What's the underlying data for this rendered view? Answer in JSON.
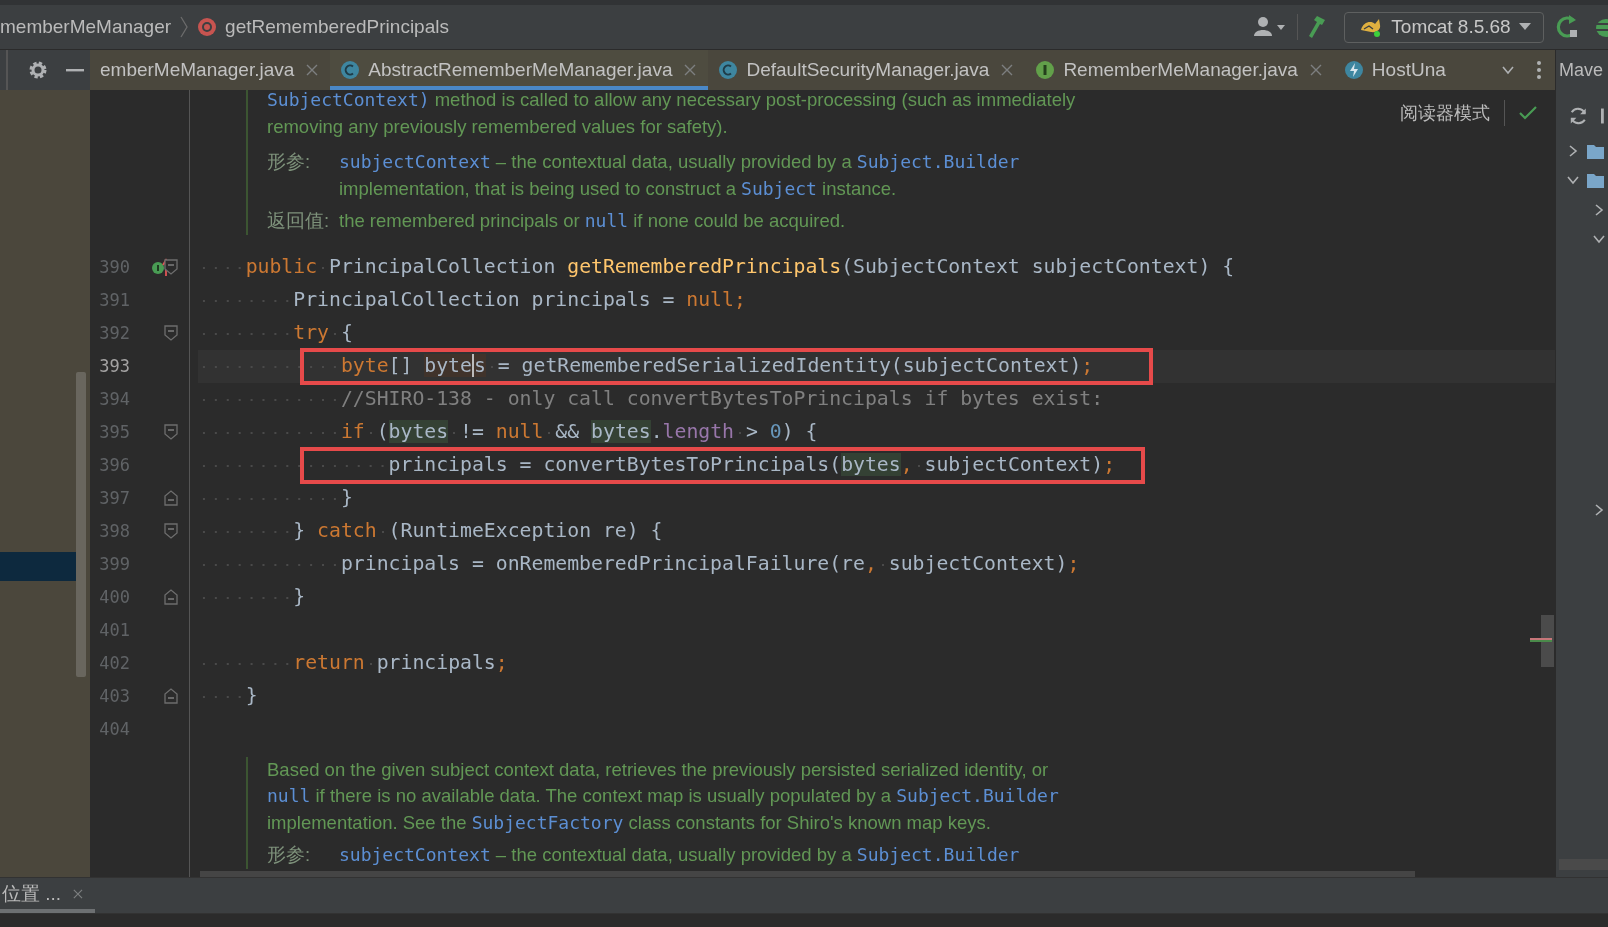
{
  "breadcrumb": [
    {
      "label": "memberMeManager"
    },
    {
      "label": "getRememberedPrincipals",
      "kind": "method"
    }
  ],
  "run_config": {
    "label": "Tomcat 8.5.68"
  },
  "tabs": [
    {
      "label": "emberMeManager.java",
      "selected": false,
      "closable": true
    },
    {
      "label": "AbstractRememberMeManager.java",
      "kind": "class",
      "selected": true,
      "closable": true
    },
    {
      "label": "DefaultSecurityManager.java",
      "kind": "class",
      "selected": false,
      "closable": true
    },
    {
      "label": "RememberMeManager.java",
      "kind": "interface",
      "selected": false,
      "closable": true
    },
    {
      "label": "HostUna",
      "kind": "bolt",
      "selected": false,
      "closable": false
    }
  ],
  "right_panel": {
    "title": "Mave",
    "tree": [
      {
        "expanded": false
      },
      {
        "expanded": true,
        "children": [
          {
            "expanded": false
          },
          {
            "expanded": true
          }
        ]
      }
    ]
  },
  "editor": {
    "reader_mode": "阅读器模式",
    "doc_top": [
      {
        "kind": "para",
        "lines": [
          [
            {
              "text": "SubjectContext)",
              "kind": "code"
            },
            {
              "text": " method is called to allow any necessary post-processing (such as immediately",
              "kind": "text"
            }
          ],
          [
            {
              "text": "removing any previously remembered values for safety).",
              "kind": "text"
            }
          ]
        ]
      },
      {
        "kind": "tag",
        "label": "形参:",
        "lines": [
          [
            {
              "text": "subjectContext",
              "kind": "code"
            },
            {
              "text": " – the contextual data, usually provided by a ",
              "kind": "text"
            },
            {
              "text": "Subject.Builder",
              "kind": "code"
            }
          ],
          [
            {
              "text": "implementation, that is being used to construct a ",
              "kind": "text"
            },
            {
              "text": "Subject",
              "kind": "code"
            },
            {
              "text": " instance.",
              "kind": "text"
            }
          ]
        ]
      },
      {
        "kind": "tag",
        "label": "返回值:",
        "lines": [
          [
            {
              "text": "the remembered principals or ",
              "kind": "text"
            },
            {
              "text": "null",
              "kind": "code"
            },
            {
              "text": " if none could be acquired.",
              "kind": "text"
            }
          ]
        ]
      }
    ],
    "code": [
      {
        "number": "390",
        "fold_start": true,
        "fold_end": false,
        "implements": true,
        "current": false,
        "boxed": false,
        "tokens": [
          {
            "text": "    public",
            "kind": "kw"
          },
          {
            "text": " PrincipalCollection ",
            "kind": "plain"
          },
          {
            "text": "getRememberedPrincipals",
            "kind": "fn"
          },
          {
            "text": "(SubjectContext subjectContext) {",
            "kind": "plain"
          }
        ]
      },
      {
        "number": "391",
        "current": false,
        "boxed": false,
        "tokens": [
          {
            "text": "        PrincipalCollection principals = ",
            "kind": "plain"
          },
          {
            "text": "null",
            "kind": "kw"
          },
          {
            "text": ";",
            "kind": "kw"
          }
        ]
      },
      {
        "number": "392",
        "fold_start": true,
        "fold_end": false,
        "current": false,
        "boxed": false,
        "tokens": [
          {
            "text": "        try",
            "kind": "kw"
          },
          {
            "text": " {",
            "kind": "plain"
          }
        ]
      },
      {
        "number": "393",
        "current": true,
        "boxed": true,
        "tokens": [
          {
            "text": "            byte",
            "kind": "kw"
          },
          {
            "text": "[] ",
            "kind": "plain"
          },
          {
            "text": "byte",
            "kind": "write"
          },
          {
            "text": "s",
            "kind": "write",
            "caret": true
          },
          {
            "text": " = getRememberedSerializedIdentity(subjectContext)",
            "kind": "plain"
          },
          {
            "text": ";",
            "kind": "kw"
          }
        ]
      },
      {
        "number": "394",
        "current": false,
        "boxed": false,
        "tokens": [
          {
            "text": "            //SHIRO-138 - only call convertBytesToPrincipals if bytes exist:",
            "kind": "comment"
          }
        ]
      },
      {
        "number": "395",
        "fold_start": true,
        "fold_end": false,
        "current": false,
        "boxed": false,
        "tokens": [
          {
            "text": "            if",
            "kind": "kw"
          },
          {
            "text": " (",
            "kind": "plain"
          },
          {
            "text": "bytes",
            "kind": "read"
          },
          {
            "text": " != ",
            "kind": "plain"
          },
          {
            "text": "null",
            "kind": "kw"
          },
          {
            "text": " && ",
            "kind": "plain"
          },
          {
            "text": "bytes",
            "kind": "read"
          },
          {
            "text": ".",
            "kind": "plain"
          },
          {
            "text": "length",
            "kind": "field"
          },
          {
            "text": " > ",
            "kind": "plain"
          },
          {
            "text": "0",
            "kind": "num"
          },
          {
            "text": ") {",
            "kind": "plain"
          }
        ]
      },
      {
        "number": "396",
        "current": false,
        "boxed": true,
        "tokens": [
          {
            "text": "                principals = convertBytesToPrincipals(",
            "kind": "plain"
          },
          {
            "text": "bytes",
            "kind": "read"
          },
          {
            "text": ",",
            "kind": "kw"
          },
          {
            "text": " subjectContext)",
            "kind": "plain"
          },
          {
            "text": ";",
            "kind": "kw"
          }
        ]
      },
      {
        "number": "397",
        "fold_start": false,
        "fold_end": true,
        "current": false,
        "boxed": false,
        "tokens": [
          {
            "text": "            }",
            "kind": "plain"
          }
        ]
      },
      {
        "number": "398",
        "fold_start": true,
        "fold_end": false,
        "current": false,
        "boxed": false,
        "tokens": [
          {
            "text": "        } ",
            "kind": "plain"
          },
          {
            "text": "catch",
            "kind": "kw"
          },
          {
            "text": " (RuntimeException re) {",
            "kind": "plain"
          }
        ]
      },
      {
        "number": "399",
        "current": false,
        "boxed": false,
        "tokens": [
          {
            "text": "            principals = onRememberedPrincipalFailure(re",
            "kind": "plain"
          },
          {
            "text": ",",
            "kind": "kw"
          },
          {
            "text": " subjectContext)",
            "kind": "plain"
          },
          {
            "text": ";",
            "kind": "kw"
          }
        ]
      },
      {
        "number": "400",
        "fold_start": false,
        "fold_end": true,
        "current": false,
        "boxed": false,
        "tokens": [
          {
            "text": "        }",
            "kind": "plain"
          }
        ]
      },
      {
        "number": "401",
        "current": false,
        "boxed": false
      },
      {
        "number": "402",
        "current": false,
        "boxed": false,
        "tokens": [
          {
            "text": "        return",
            "kind": "kw"
          },
          {
            "text": " principals",
            "kind": "plain"
          },
          {
            "text": ";",
            "kind": "kw"
          }
        ]
      },
      {
        "number": "403",
        "fold_start": false,
        "fold_end": true,
        "current": false,
        "boxed": false,
        "tokens": [
          {
            "text": "    }",
            "kind": "plain"
          }
        ]
      },
      {
        "number": "404",
        "current": false,
        "boxed": false
      }
    ],
    "doc_bottom": [
      {
        "kind": "para",
        "lines": [
          [
            {
              "text": "Based on the given subject context data, retrieves the previously persisted serialized identity, or",
              "kind": "text"
            }
          ],
          [
            {
              "text": "null",
              "kind": "code"
            },
            {
              "text": " if there is no available data. The context map is usually populated by a ",
              "kind": "text"
            },
            {
              "text": "Subject.Builder",
              "kind": "code"
            }
          ],
          [
            {
              "text": "implementation. See the ",
              "kind": "text"
            },
            {
              "text": "SubjectFactory",
              "kind": "code"
            },
            {
              "text": " class constants for Shiro's known map keys.",
              "kind": "text"
            }
          ]
        ]
      },
      {
        "kind": "tag",
        "label": "形参:",
        "lines": [
          [
            {
              "text": "subjectContext",
              "kind": "code"
            },
            {
              "text": " – the contextual data, usually provided by a ",
              "kind": "text"
            },
            {
              "text": "Subject.Builder",
              "kind": "code"
            }
          ]
        ]
      }
    ]
  },
  "bottom_tabs": [
    {
      "label": "位置 ...",
      "selected": true
    }
  ]
}
